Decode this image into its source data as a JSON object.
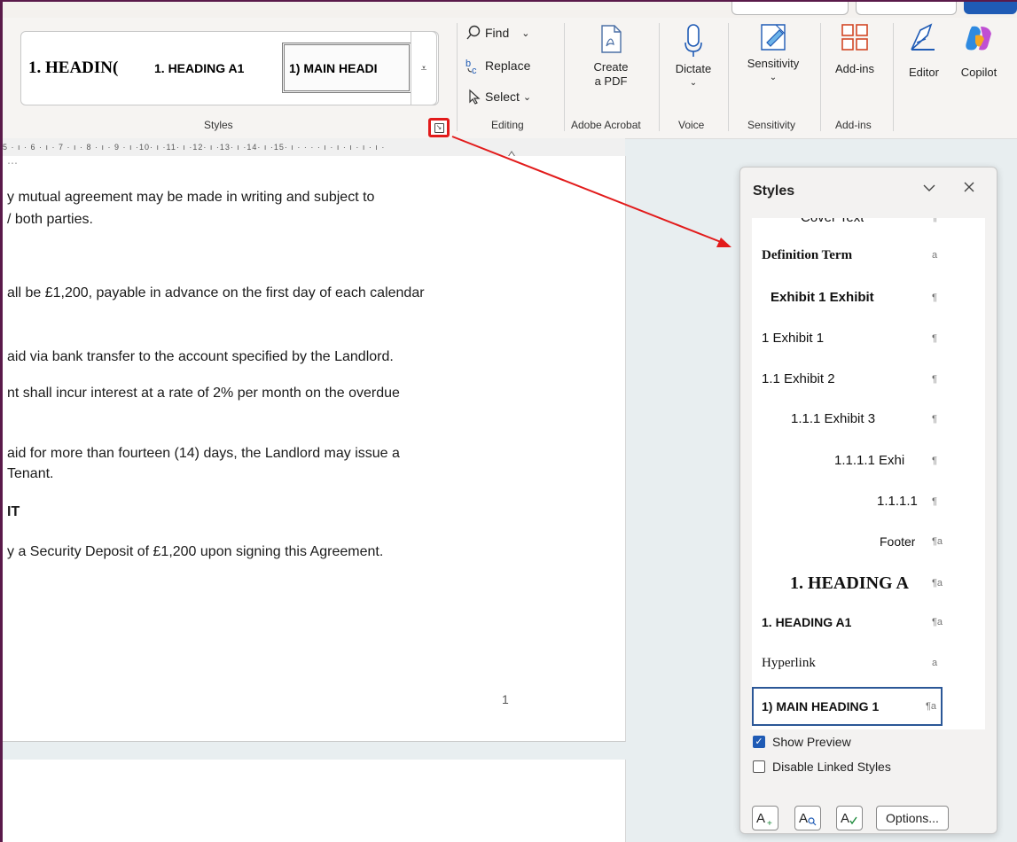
{
  "ribbon": {
    "styles_gallery": {
      "items": [
        "1. HEADIN(",
        "1.  HEADING A1",
        "1)  MAIN HEADI"
      ],
      "group_label": "Styles"
    },
    "editing": {
      "find": "Find",
      "replace": "Replace",
      "select": "Select",
      "group_label": "Editing"
    },
    "adobe": {
      "button": "Create\na PDF",
      "group_label": "Adobe Acrobat"
    },
    "voice": {
      "button": "Dictate",
      "group_label": "Voice"
    },
    "sensitivity": {
      "button": "Sensitivity",
      "group_label": "Sensitivity"
    },
    "addins": {
      "button": "Add-ins",
      "group_label": "Add-ins"
    },
    "editor": {
      "button": "Editor"
    },
    "copilot": {
      "button": "Copilot"
    }
  },
  "ruler": {
    "text": "5 · ı · 6 · ı · 7 · ı · 8 · ı · 9 · ı ·10· ı ·11· ı ·12· ı ·13· ı ·14· ı ·15· ı · · · · ı · ı · ı · ı · ı ·"
  },
  "document": {
    "lines": [
      "y mutual agreement may be made in writing and subject to",
      "/ both parties.",
      "all be £1,200, payable in advance on the first day of each calendar",
      "aid via bank transfer to the account specified by the Landlord.",
      "nt shall incur interest at a rate of 2% per month on the overdue",
      "aid for more than fourteen (14) days, the Landlord may issue a",
      "Tenant.",
      "IT",
      "y a Security Deposit of £1,200 upon signing this Agreement."
    ],
    "page_number": "1"
  },
  "styles_pane": {
    "title": "Styles",
    "items": [
      {
        "name": "Cover Text",
        "mark": "¶"
      },
      {
        "name": "Definition Term",
        "mark": "a"
      },
      {
        "name": "Exhibit 1  Exhibit",
        "mark": "¶"
      },
      {
        "name": "1  Exhibit 1",
        "mark": "¶"
      },
      {
        "name": "1.1  Exhibit 2",
        "mark": "¶"
      },
      {
        "name": "1.1.1  Exhibit 3",
        "mark": "¶"
      },
      {
        "name": "1.1.1.1  Exhi",
        "mark": "¶"
      },
      {
        "name": "1.1.1.1",
        "mark": "¶"
      },
      {
        "name": "Footer",
        "mark": "¶a"
      },
      {
        "name": "1.  HEADING A",
        "mark": "¶a"
      },
      {
        "name": "1.  HEADING A1",
        "mark": "¶a"
      },
      {
        "name": "Hyperlink",
        "mark": "a"
      },
      {
        "name": "1)  MAIN HEADING 1",
        "mark": "¶a"
      }
    ],
    "show_preview": {
      "label": "Show Preview",
      "checked": true
    },
    "disable_linked": {
      "label": "Disable Linked Styles",
      "checked": false
    },
    "options_button": "Options..."
  },
  "colors": {
    "annotation_red": "#e21b1b",
    "accent_blue": "#1f5bb5",
    "selection_border": "#2b5797"
  }
}
